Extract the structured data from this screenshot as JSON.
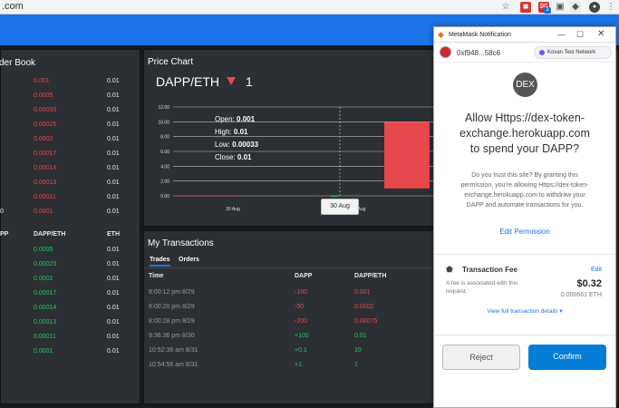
{
  "browser": {
    "url_fragment": ".com",
    "ext_badge": "1"
  },
  "order_book": {
    "title": "der Book",
    "sell_orders": [
      {
        "price": "0.001",
        "eth": "0.01"
      },
      {
        "price": "0.0005",
        "eth": "0.01"
      },
      {
        "price": "0.00033",
        "eth": "0.01"
      },
      {
        "price": "0.00025",
        "eth": "0.01"
      },
      {
        "price": "0.0002",
        "eth": "0.01"
      },
      {
        "price": "0.00017",
        "eth": "0.01"
      },
      {
        "price": "0.00014",
        "eth": "0.01"
      },
      {
        "price": "0.00013",
        "eth": "0.01"
      },
      {
        "price": "0.00011",
        "eth": "0.01"
      },
      {
        "price": "0.0001",
        "eth": "0.01"
      }
    ],
    "sell_amount_partial": [
      "",
      "",
      "",
      "",
      "",
      "",
      "",
      "",
      "",
      "0"
    ],
    "header": {
      "col1": "PP",
      "col2": "DAPP/ETH",
      "col3": "ETH"
    },
    "buy_orders": [
      {
        "price": "0.0005",
        "eth": "0.01"
      },
      {
        "price": "0.00025",
        "eth": "0.01"
      },
      {
        "price": "0.0002",
        "eth": "0.01"
      },
      {
        "price": "0.00017",
        "eth": "0.01"
      },
      {
        "price": "0.00014",
        "eth": "0.01"
      },
      {
        "price": "0.00013",
        "eth": "0.01"
      },
      {
        "price": "0.00011",
        "eth": "0.01"
      },
      {
        "price": "0.0001",
        "eth": "0.01"
      }
    ]
  },
  "price_chart": {
    "title": "Price Chart",
    "pair": "DAPP/ETH",
    "price": "1",
    "trend_icon": "down-triangle-icon",
    "ohlc": {
      "open_label": "Open:",
      "open": "0.001",
      "high_label": "High:",
      "high": "0.01",
      "low_label": "Low:",
      "low": "0.00033",
      "close_label": "Close:",
      "close": "0.01"
    },
    "tooltip_date": "30 Aug",
    "x_tick_1": "30 Aug",
    "x_tick_2": "Aug"
  },
  "chart_data": {
    "type": "candlestick",
    "y_ticks": [
      "12.00",
      "10.00",
      "8.00",
      "6.00",
      "4.00",
      "2.00",
      "0.00"
    ],
    "ylim": [
      0,
      12
    ],
    "x_ticks": [
      "30 Aug",
      "Aug"
    ],
    "candles": [
      {
        "x": "30 Aug",
        "open": 0.001,
        "high": 0.01,
        "low": 0.00033,
        "close": 0.01
      },
      {
        "x": "31 Aug",
        "open": 10,
        "high": 10,
        "low": 1,
        "close": 1
      }
    ],
    "colors": {
      "down": "#e5484d",
      "up": "#29c466"
    }
  },
  "transactions": {
    "title": "My Transactions",
    "tabs": [
      "Trades",
      "Orders"
    ],
    "headers": [
      "Time",
      "DAPP",
      "DAPP/ETH"
    ],
    "rows": [
      {
        "time": "8:00:12 pm 8/29",
        "dapp": "-100",
        "price": "0.001",
        "side": "sell"
      },
      {
        "time": "8:00:20 pm 8/29",
        "dapp": "-50",
        "price": "0.0002",
        "side": "sell"
      },
      {
        "time": "8:00:28 pm 8/29",
        "dapp": "-200",
        "price": "0.00075",
        "side": "sell"
      },
      {
        "time": "9:36:36 pm 8/30",
        "dapp": "+100",
        "price": "0.01",
        "side": "buy"
      },
      {
        "time": "10:52:36 am 8/31",
        "dapp": "+0.1",
        "price": "10",
        "side": "buy"
      },
      {
        "time": "10:54:56 am 8/31",
        "dapp": "+1",
        "price": "1",
        "side": "buy"
      }
    ]
  },
  "metamask": {
    "window_title": "MetaMask Notification",
    "account": "0xf948...58c6",
    "network": "Kovan Test Network",
    "token_logo": "DEX",
    "heading_line1": "Allow Https://dex-token-",
    "heading_line2": "exchange.herokuapp.com",
    "heading_line3": "to spend your DAPP?",
    "body_line1": "Do you trust this site? By granting this",
    "body_line2": "permission, you're allowing Https://dex-token-",
    "body_line3": "exchange.herokuapp.com to withdraw your",
    "body_line4": "DAPP and automate transactions for you.",
    "edit_permission": "Edit Permission",
    "fee_title": "Transaction Fee",
    "fee_edit": "Edit",
    "fee_desc_line1": "A fee is associated with this",
    "fee_desc_line2": "request.",
    "fee_usd": "$0.32",
    "fee_eth": "0.000661 ETH",
    "view_details": "View full transaction details",
    "reject": "Reject",
    "confirm": "Confirm"
  }
}
